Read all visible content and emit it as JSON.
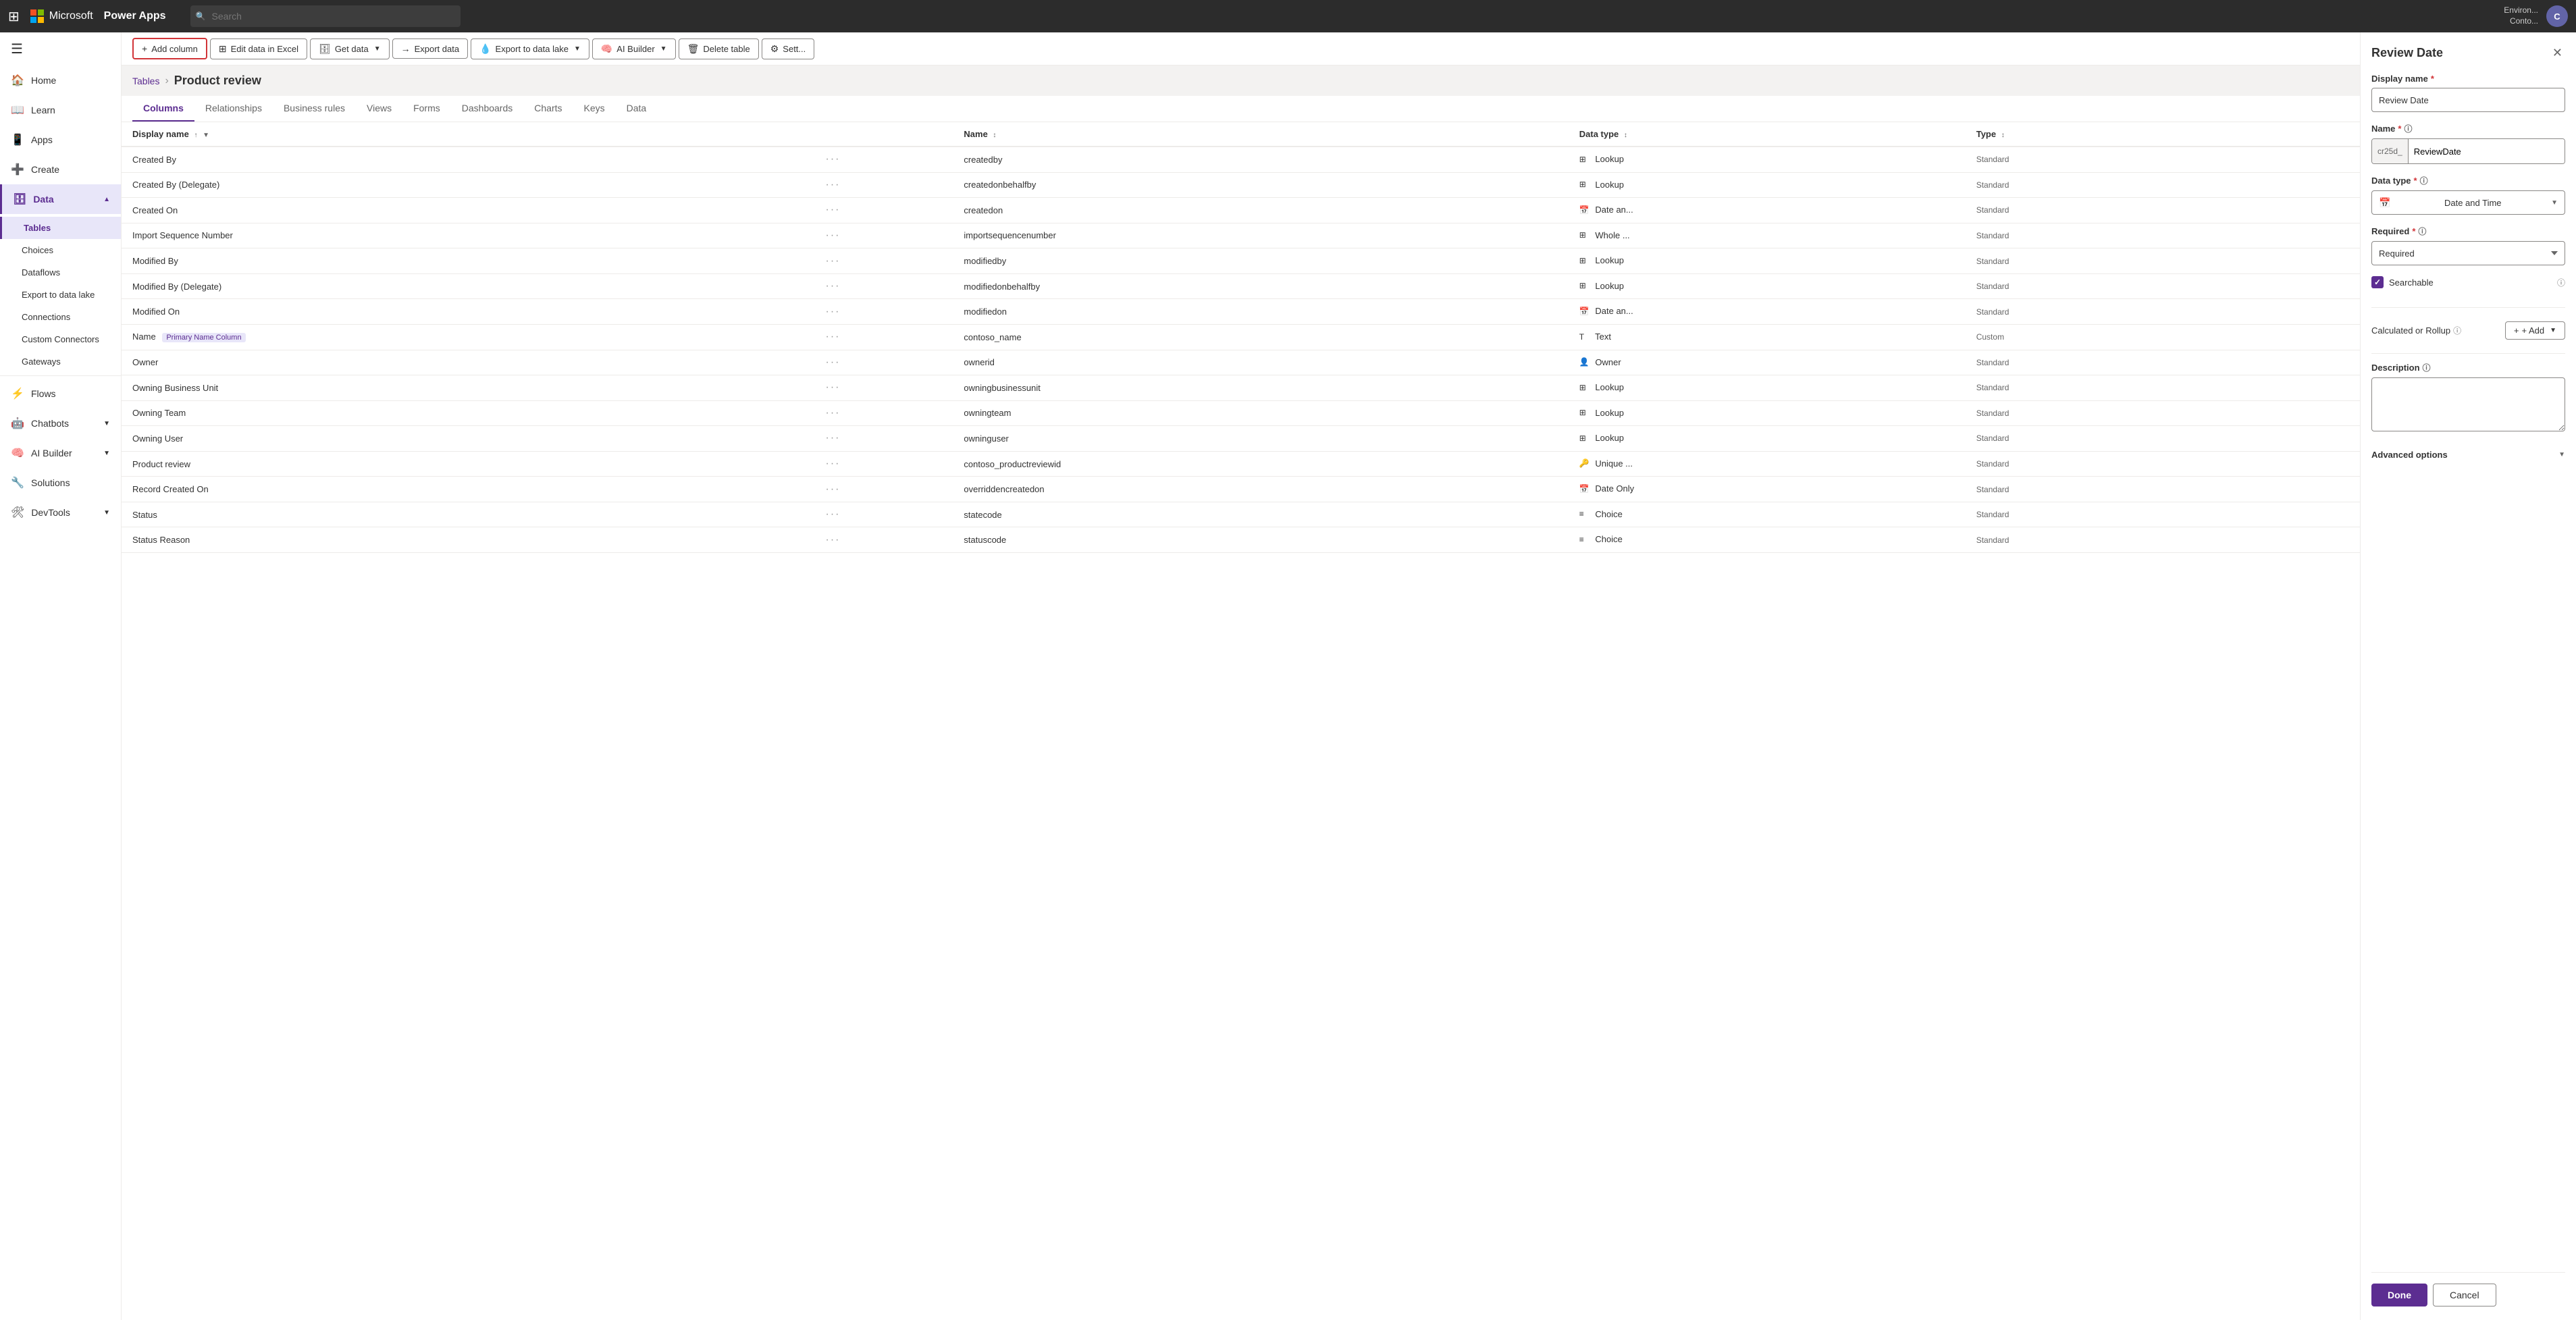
{
  "topbar": {
    "grid_icon": "⊞",
    "company": "Microsoft",
    "app": "Power Apps",
    "search_placeholder": "Search",
    "env_label": "Environ...",
    "env_sub": "Conto...",
    "avatar_initials": "C"
  },
  "sidebar": {
    "toggle_icon": "☰",
    "items": [
      {
        "id": "home",
        "icon": "🏠",
        "label": "Home",
        "active": false
      },
      {
        "id": "learn",
        "icon": "📖",
        "label": "Learn",
        "active": false
      },
      {
        "id": "apps",
        "icon": "📱",
        "label": "Apps",
        "active": false
      },
      {
        "id": "create",
        "icon": "➕",
        "label": "Create",
        "active": false
      },
      {
        "id": "data",
        "icon": "🗄",
        "label": "Data",
        "active": true,
        "expanded": true
      }
    ],
    "data_sub_items": [
      {
        "id": "tables",
        "label": "Tables",
        "active": true
      },
      {
        "id": "choices",
        "label": "Choices",
        "active": false
      },
      {
        "id": "dataflows",
        "label": "Dataflows",
        "active": false
      },
      {
        "id": "export",
        "label": "Export to data lake",
        "active": false
      },
      {
        "id": "connections",
        "label": "Connections",
        "active": false
      },
      {
        "id": "custom_connectors",
        "label": "Custom Connectors",
        "active": false
      },
      {
        "id": "gateways",
        "label": "Gateways",
        "active": false
      }
    ],
    "other_items": [
      {
        "id": "flows",
        "icon": "⚡",
        "label": "Flows",
        "active": false
      },
      {
        "id": "chatbots",
        "icon": "🤖",
        "label": "Chatbots",
        "active": false,
        "has_chevron": true
      },
      {
        "id": "ai_builder",
        "icon": "🧠",
        "label": "AI Builder",
        "active": false,
        "has_chevron": true
      },
      {
        "id": "solutions",
        "icon": "🔧",
        "label": "Solutions",
        "active": false
      },
      {
        "id": "devtools",
        "icon": "🛠",
        "label": "DevTools",
        "active": false,
        "has_chevron": true
      }
    ]
  },
  "toolbar": {
    "add_column": "Add column",
    "edit_excel": "Edit data in Excel",
    "get_data": "Get data",
    "export_data": "Export data",
    "export_lake": "Export to data lake",
    "ai_builder": "AI Builder",
    "delete_table": "Delete table",
    "settings": "Sett..."
  },
  "breadcrumb": {
    "parent": "Tables",
    "current": "Product review"
  },
  "tabs": [
    {
      "id": "columns",
      "label": "Columns",
      "active": true
    },
    {
      "id": "relationships",
      "label": "Relationships",
      "active": false
    },
    {
      "id": "business_rules",
      "label": "Business rules",
      "active": false
    },
    {
      "id": "views",
      "label": "Views",
      "active": false
    },
    {
      "id": "forms",
      "label": "Forms",
      "active": false
    },
    {
      "id": "dashboards",
      "label": "Dashboards",
      "active": false
    },
    {
      "id": "charts",
      "label": "Charts",
      "active": false
    },
    {
      "id": "keys",
      "label": "Keys",
      "active": false
    },
    {
      "id": "data",
      "label": "Data",
      "active": false
    }
  ],
  "table_columns": {
    "headers": [
      {
        "id": "display_name",
        "label": "Display name",
        "sortable": true,
        "sort": "asc"
      },
      {
        "id": "more",
        "label": ""
      },
      {
        "id": "name",
        "label": "Name",
        "sortable": true
      },
      {
        "id": "data_type",
        "label": "Data type",
        "sortable": true
      },
      {
        "id": "type",
        "label": "Type",
        "sortable": true
      },
      {
        "id": "more2",
        "label": ""
      }
    ],
    "rows": [
      {
        "display_name": "Created By",
        "name": "createdby",
        "data_type": "Lookup",
        "data_type_icon": "⊞",
        "type": "Standard"
      },
      {
        "display_name": "Created By (Delegate)",
        "name": "createdonbehalfby",
        "data_type": "Lookup",
        "data_type_icon": "⊞",
        "type": "Standard"
      },
      {
        "display_name": "Created On",
        "name": "createdon",
        "data_type": "Date an...",
        "data_type_icon": "📅",
        "type": "Standard"
      },
      {
        "display_name": "Import Sequence Number",
        "name": "importsequencenumber",
        "data_type": "Whole ...",
        "data_type_icon": "⊞",
        "type": "Standard"
      },
      {
        "display_name": "Modified By",
        "name": "modifiedby",
        "data_type": "Lookup",
        "data_type_icon": "⊞",
        "type": "Standard"
      },
      {
        "display_name": "Modified By (Delegate)",
        "name": "modifiedonbehalfby",
        "data_type": "Lookup",
        "data_type_icon": "⊞",
        "type": "Standard"
      },
      {
        "display_name": "Modified On",
        "name": "modifiedon",
        "data_type": "Date an...",
        "data_type_icon": "📅",
        "type": "Standard"
      },
      {
        "display_name": "Name",
        "name": "contoso_name",
        "badge": "Primary Name Column",
        "data_type": "Text",
        "data_type_icon": "T",
        "type": "Custom"
      },
      {
        "display_name": "Owner",
        "name": "ownerid",
        "data_type": "Owner",
        "data_type_icon": "👤",
        "type": "Standard"
      },
      {
        "display_name": "Owning Business Unit",
        "name": "owningbusinessunit",
        "data_type": "Lookup",
        "data_type_icon": "⊞",
        "type": "Standard"
      },
      {
        "display_name": "Owning Team",
        "name": "owningteam",
        "data_type": "Lookup",
        "data_type_icon": "⊞",
        "type": "Standard"
      },
      {
        "display_name": "Owning User",
        "name": "owninguser",
        "data_type": "Lookup",
        "data_type_icon": "⊞",
        "type": "Standard"
      },
      {
        "display_name": "Product review",
        "name": "contoso_productreviewid",
        "data_type": "Unique ...",
        "data_type_icon": "🔑",
        "type": "Standard"
      },
      {
        "display_name": "Record Created On",
        "name": "overriddencreatedon",
        "data_type": "Date Only",
        "data_type_icon": "📅",
        "type": "Standard"
      },
      {
        "display_name": "Status",
        "name": "statecode",
        "data_type": "Choice",
        "data_type_icon": "≡",
        "type": "Standard"
      },
      {
        "display_name": "Status Reason",
        "name": "statuscode",
        "data_type": "Choice",
        "data_type_icon": "≡",
        "type": "Standard"
      }
    ]
  },
  "panel": {
    "title": "Review Date",
    "display_name_label": "Display name",
    "display_name_value": "Review Date",
    "name_label": "Name",
    "name_prefix": "cr25d_",
    "name_value": "ReviewDate",
    "data_type_label": "Data type",
    "data_type_icon": "📅",
    "data_type_value": "Date and Time",
    "required_label": "Required",
    "required_value": "Required",
    "searchable_label": "Searchable",
    "searchable_checked": true,
    "calc_label": "Calculated or Rollup",
    "add_label": "+ Add",
    "description_label": "Description",
    "description_placeholder": "",
    "advanced_label": "Advanced options",
    "done_label": "Done",
    "cancel_label": "Cancel"
  }
}
